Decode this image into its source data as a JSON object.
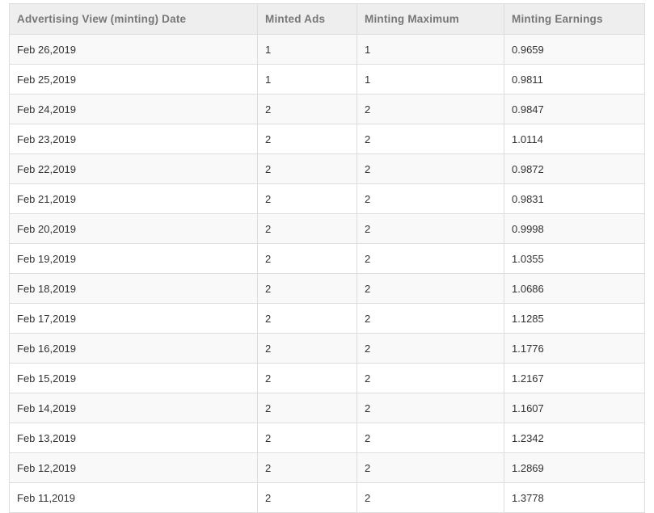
{
  "table": {
    "headers": [
      "Advertising View (minting) Date",
      "Minted Ads",
      "Minting Maximum",
      "Minting Earnings"
    ],
    "rows": [
      [
        "Feb 26,2019",
        "1",
        "1",
        "0.9659"
      ],
      [
        "Feb 25,2019",
        "1",
        "1",
        "0.9811"
      ],
      [
        "Feb 24,2019",
        "2",
        "2",
        "0.9847"
      ],
      [
        "Feb 23,2019",
        "2",
        "2",
        "1.0114"
      ],
      [
        "Feb 22,2019",
        "2",
        "2",
        "0.9872"
      ],
      [
        "Feb 21,2019",
        "2",
        "2",
        "0.9831"
      ],
      [
        "Feb 20,2019",
        "2",
        "2",
        "0.9998"
      ],
      [
        "Feb 19,2019",
        "2",
        "2",
        "1.0355"
      ],
      [
        "Feb 18,2019",
        "2",
        "2",
        "1.0686"
      ],
      [
        "Feb 17,2019",
        "2",
        "2",
        "1.1285"
      ],
      [
        "Feb 16,2019",
        "2",
        "2",
        "1.1776"
      ],
      [
        "Feb 15,2019",
        "2",
        "2",
        "1.2167"
      ],
      [
        "Feb 14,2019",
        "2",
        "2",
        "1.1607"
      ],
      [
        "Feb 13,2019",
        "2",
        "2",
        "1.2342"
      ],
      [
        "Feb 12,2019",
        "2",
        "2",
        "1.2869"
      ],
      [
        "Feb 11,2019",
        "2",
        "2",
        "1.3778"
      ]
    ]
  },
  "colors": {
    "header_bg": "#eeeeee",
    "header_text": "#777777",
    "row_odd": "#f9f9f9",
    "row_even": "#ffffff",
    "border": "#dddddd"
  }
}
